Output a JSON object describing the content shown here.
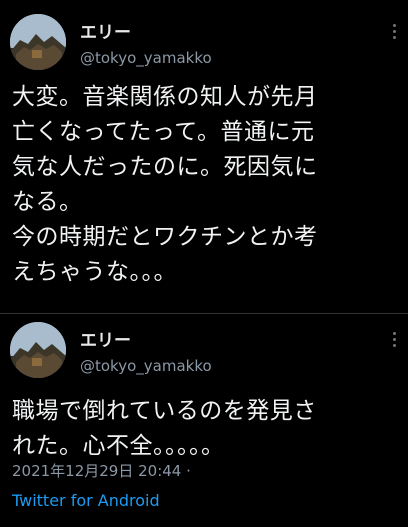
{
  "tweets": [
    {
      "display_name": "エリー",
      "handle": "@tokyo_yamakko",
      "text": "大変。音楽関係の知人が先月\n亡くなってたって。普通に元\n気な人だったのに。死因気に\nなる。\n今の時期だとワクチンとか考\nえちゃうな。。。"
    },
    {
      "display_name": "エリー",
      "handle": "@tokyo_yamakko",
      "text": "職場で倒れているのを発見さ\nれた。心不全。。。。。",
      "timestamp": "2021年12月29日 20:44 ·",
      "source": "Twitter for Android"
    }
  ],
  "colors": {
    "background": "#000000",
    "text": "#e7e9ea",
    "muted": "#8b98a5",
    "link": "#1d9bf0",
    "divider": "#2f3336"
  },
  "icons": [
    "avatar-image",
    "more-options-icon"
  ]
}
